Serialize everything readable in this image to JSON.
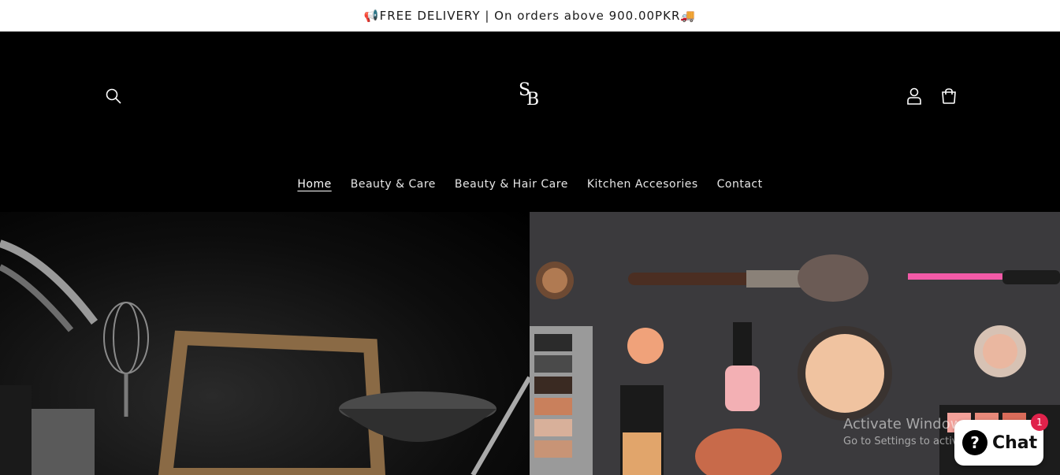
{
  "announcement": {
    "left_emoji": "📢",
    "text": "FREE DELIVERY | On orders above 900.00PKR",
    "right_emoji": "🚚"
  },
  "header": {
    "logo_letters": [
      "S",
      "B"
    ],
    "icons": [
      "search-icon",
      "account-icon",
      "cart-icon"
    ]
  },
  "nav": {
    "items": [
      {
        "label": "Home"
      },
      {
        "label": "Beauty & Care"
      },
      {
        "label": "Beauty & Hair Care"
      },
      {
        "label": "Kitchen Accesories"
      },
      {
        "label": "Contact"
      }
    ]
  },
  "watermark": {
    "line1": "Activate Windows",
    "line2": "Go to Settings to activate Windows."
  },
  "chat": {
    "label": "Chat",
    "badge": "1"
  },
  "colors": {
    "topbar_bg": "#ffffff",
    "header_bg": "#000000",
    "nav_text": "#e6e6e6",
    "badge": "#e0224b"
  }
}
